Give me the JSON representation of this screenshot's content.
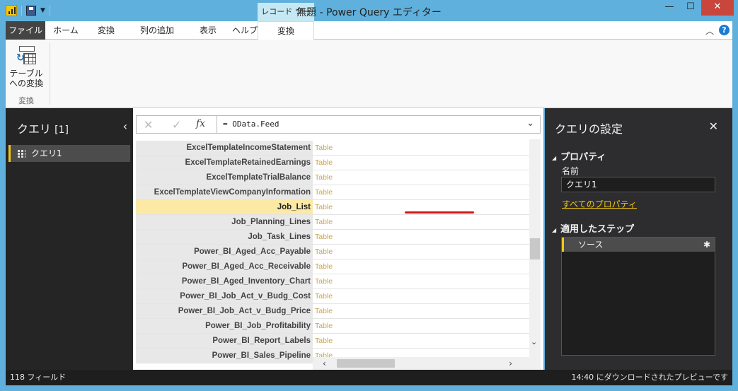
{
  "window": {
    "title": "無題 - Power Query エディター",
    "contextual_tab_group": "レコード ツール",
    "minimize": "—",
    "maximize": "☐",
    "close": "✕"
  },
  "ribbon": {
    "tabs": [
      "ファイル",
      "ホーム",
      "変換",
      "列の追加",
      "表示",
      "ヘルプ",
      "変換"
    ],
    "to_table_label_1": "テーブル",
    "to_table_label_2": "への変換",
    "group_label": "変換",
    "collapse": "︿",
    "help": "?"
  },
  "queries": {
    "title": "クエリ",
    "count": "[1]",
    "collapse": "‹",
    "items": [
      "クエリ1"
    ]
  },
  "formula_bar": {
    "cancel": "✕",
    "confirm": "✓",
    "fx": "fx",
    "formula": "= OData.Feed",
    "expand": "⌄"
  },
  "record": {
    "rows": [
      {
        "name": "ExcelTemplateIncomeStatement",
        "value": "Table"
      },
      {
        "name": "ExcelTemplateRetainedEarnings",
        "value": "Table"
      },
      {
        "name": "ExcelTemplateTrialBalance",
        "value": "Table"
      },
      {
        "name": "ExcelTemplateViewCompanyInformation",
        "value": "Table"
      },
      {
        "name": "Job_List",
        "value": "Table"
      },
      {
        "name": "Job_Planning_Lines",
        "value": "Table"
      },
      {
        "name": "Job_Task_Lines",
        "value": "Table"
      },
      {
        "name": "Power_BI_Aged_Acc_Payable",
        "value": "Table"
      },
      {
        "name": "Power_BI_Aged_Acc_Receivable",
        "value": "Table"
      },
      {
        "name": "Power_BI_Aged_Inventory_Chart",
        "value": "Table"
      },
      {
        "name": "Power_BI_Job_Act_v_Budg_Cost",
        "value": "Table"
      },
      {
        "name": "Power_BI_Job_Act_v_Budg_Price",
        "value": "Table"
      },
      {
        "name": "Power_BI_Job_Profitability",
        "value": "Table"
      },
      {
        "name": "Power_BI_Report_Labels",
        "value": "Table"
      },
      {
        "name": "Power_BI_Sales_Pipeline",
        "value": "Table"
      }
    ],
    "selected_index": 4
  },
  "settings": {
    "title": "クエリの設定",
    "close": "✕",
    "properties_header": "プロパティ",
    "name_label": "名前",
    "name_value": "クエリ1",
    "all_properties_link": "すべてのプロパティ",
    "applied_steps_header": "適用したステップ",
    "steps": [
      "ソース"
    ]
  },
  "status": {
    "left": "118 フィールド",
    "right": "14:40 にダウンロードされたプレビューです"
  },
  "colors": {
    "title_bar": "#5fb0dc",
    "accent": "#f2c811",
    "value_text": "#c9a74f",
    "selected_row": "#fce9a6",
    "annotation": "#d21818"
  }
}
